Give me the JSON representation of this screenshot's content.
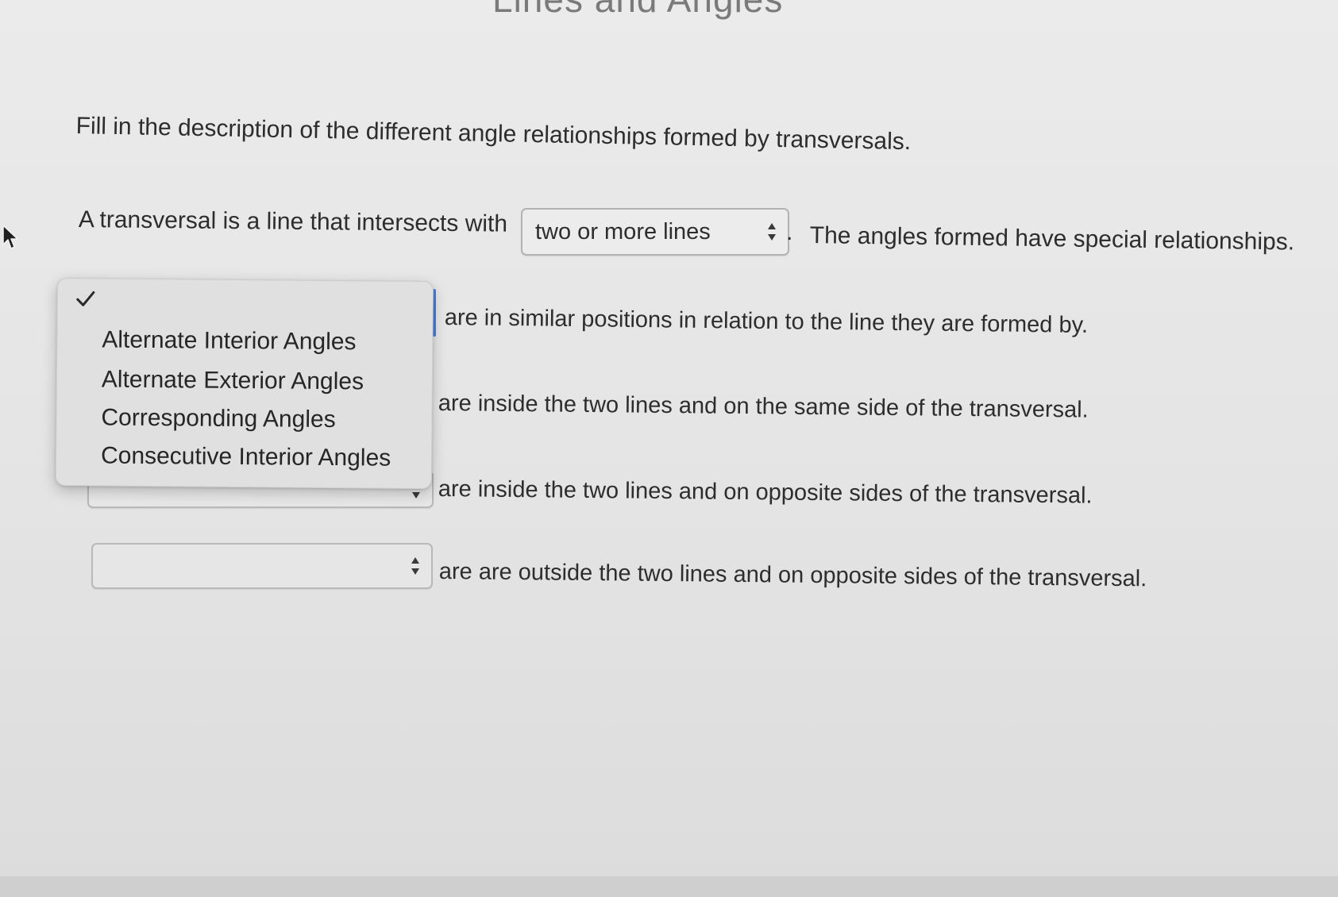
{
  "header": {
    "title_partial": "Lines and Angles"
  },
  "instructions": "Fill in the description of the different angle relationships formed by transversals.",
  "sentence_1": {
    "start": "A transversal is a line that intersects with",
    "select_value": "two or more lines",
    "period": ".",
    "end": "The angles formed have special relationships."
  },
  "relationships": [
    {
      "description": "are in similar positions in relation to the line they are formed by."
    },
    {
      "description": "are inside the two lines and on the same side of the transversal."
    },
    {
      "description": "are inside the two lines and on opposite sides of the transversal."
    },
    {
      "description": "are are outside the two lines and on opposite sides of the transversal."
    }
  ],
  "dropdown": {
    "selected_index": -1,
    "options": [
      "Alternate Interior Angles",
      "Alternate Exterior Angles",
      "Corresponding Angles",
      "Consecutive Interior Angles"
    ]
  },
  "icons": {
    "check": "checkmark-icon",
    "stepper": "up-down-stepper-icon",
    "cursor": "mouse-pointer-icon"
  },
  "colors": {
    "focus_ring": "#4a7fd8",
    "menu_background": "#e0e0e0",
    "text": "#2d2d2d"
  }
}
